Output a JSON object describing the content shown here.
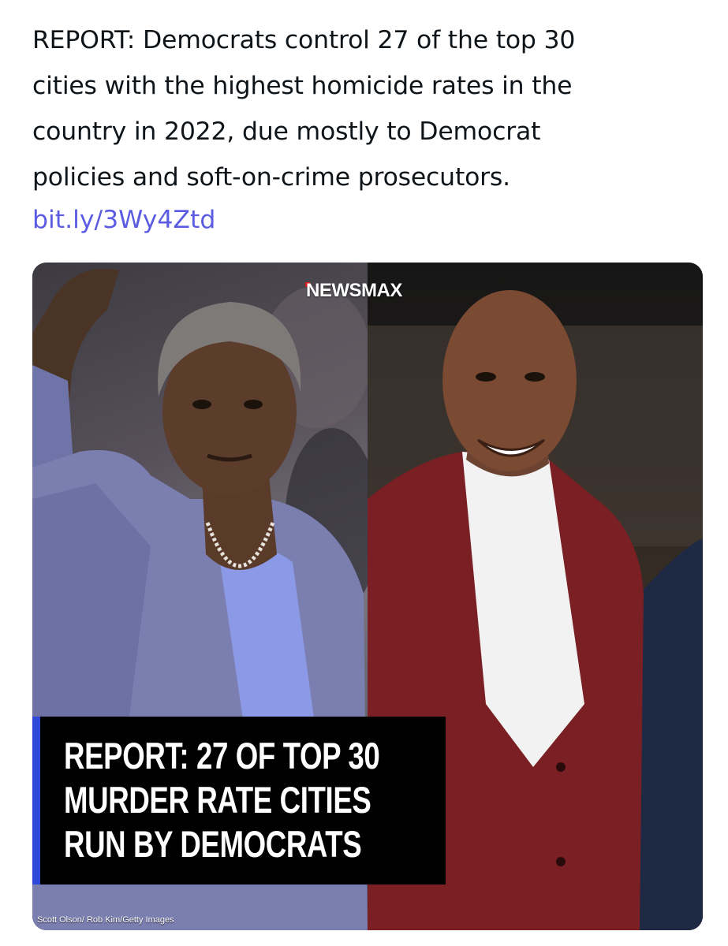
{
  "post": {
    "text_lines": [
      "REPORT: Democrats control 27 of the top 30",
      "cities with the highest homicide rates in the",
      "country in 2022, due mostly to Democrat",
      "policies and soft-on-crime prosecutors."
    ],
    "link": "bit.ly/3Wy4Ztd"
  },
  "media": {
    "brand": "NEWSMAX",
    "headline_lines": [
      "REPORT: 27 OF TOP 30",
      "MURDER RATE CITIES",
      "RUN BY DEMOCRATS"
    ],
    "credit": "Scott Olson/ Rob Kim/Getty Images"
  },
  "colors": {
    "text": "#0f1419",
    "link": "#5b5ce2",
    "headline_bg": "#000000",
    "headline_stripe": "#2f48d8"
  }
}
